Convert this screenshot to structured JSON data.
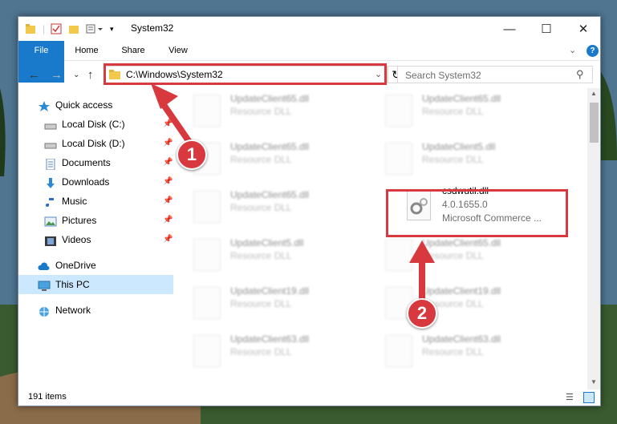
{
  "window": {
    "title": "System32"
  },
  "ribbon": {
    "tabs": [
      "File",
      "Home",
      "Share",
      "View"
    ]
  },
  "address": {
    "path": "C:\\Windows\\System32"
  },
  "search": {
    "placeholder": "Search System32"
  },
  "sidebar": {
    "items": [
      {
        "label": "Quick access",
        "icon": "star-icon",
        "pinned": false
      },
      {
        "label": "Local Disk (C:)",
        "icon": "drive-icon",
        "pinned": true
      },
      {
        "label": "Local Disk (D:)",
        "icon": "drive-icon",
        "pinned": true
      },
      {
        "label": "Documents",
        "icon": "documents-icon",
        "pinned": true
      },
      {
        "label": "Downloads",
        "icon": "download-icon",
        "pinned": true
      },
      {
        "label": "Music",
        "icon": "music-icon",
        "pinned": true
      },
      {
        "label": "Pictures",
        "icon": "pictures-icon",
        "pinned": true
      },
      {
        "label": "Videos",
        "icon": "videos-icon",
        "pinned": true
      },
      {
        "label": "OneDrive",
        "icon": "cloud-icon",
        "pinned": false
      },
      {
        "label": "This PC",
        "icon": "computer-icon",
        "pinned": false,
        "selected": true
      },
      {
        "label": "Network",
        "icon": "network-icon",
        "pinned": false
      }
    ]
  },
  "files": [
    {
      "name": "UpdateClient65.dll",
      "type": "Resource DLL"
    },
    {
      "name": "UpdateClient65.dll",
      "type": "Resource DLL"
    },
    {
      "name": "UpdateClient65.dll",
      "type": "Resource DLL"
    },
    {
      "name": "UpdateClient5.dll",
      "type": "Resource DLL"
    },
    {
      "name": "UpdateClient65.dll",
      "type": "Resource DLL"
    },
    {
      "name": "csdwutil.dll",
      "version": "4.0.1655.0",
      "company": "Microsoft Commerce ...",
      "highlighted": true
    },
    {
      "name": "UpdateClient5.dll",
      "type": "Resource DLL"
    },
    {
      "name": "UpdateClient65.dll",
      "type": "Resource DLL"
    },
    {
      "name": "UpdateClient19.dll",
      "type": "Resource DLL"
    },
    {
      "name": "UpdateClient19.dll",
      "type": "Resource DLL"
    },
    {
      "name": "UpdateClient63.dll",
      "type": "Resource DLL"
    },
    {
      "name": "UpdateClient63.dll",
      "type": "Resource DLL"
    }
  ],
  "status": {
    "item_count": "191 items"
  },
  "callouts": [
    "1",
    "2"
  ],
  "colors": {
    "accent": "#1979ca",
    "highlight": "#d8393f",
    "selected": "#cce8ff"
  }
}
